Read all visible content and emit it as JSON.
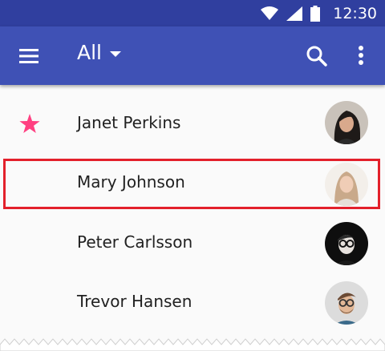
{
  "status_bar": {
    "time": "12:30",
    "icons": [
      "wifi-icon",
      "cell-signal-icon",
      "battery-icon"
    ]
  },
  "app_bar": {
    "title": "All",
    "icons": [
      "menu-icon",
      "dropdown-caret-icon",
      "search-icon",
      "more-vert-icon"
    ]
  },
  "contacts": [
    {
      "name": "Janet Perkins",
      "starred": true
    },
    {
      "name": "Mary Johnson",
      "starred": false,
      "highlighted": true
    },
    {
      "name": "Peter Carlsson",
      "starred": false
    },
    {
      "name": "Trevor Hansen",
      "starred": false
    }
  ],
  "colors": {
    "status_bar": "#303f9f",
    "app_bar": "#3f51b5",
    "star": "#ff4081",
    "highlight": "#e3202b",
    "background": "#fafafa"
  }
}
